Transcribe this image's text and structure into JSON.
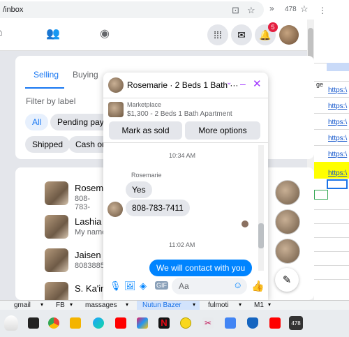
{
  "browser": {
    "url": "/inbox",
    "ext_count": "478"
  },
  "facebook": {
    "notif_badge": "5"
  },
  "sheet": {
    "cell_text": "ge",
    "links": [
      "https:\\",
      "https:\\",
      "https:\\",
      "https:\\",
      "https:\\",
      "https:\\",
      "https:\\"
    ]
  },
  "marketplace": {
    "tabs": [
      "Selling",
      "Buying"
    ],
    "filter_label": "Filter by label",
    "chips": [
      "All",
      "Pending paym",
      "Shipped",
      "Cash on"
    ],
    "listings": [
      {
        "name": "Rosema",
        "sub": "808-783-"
      },
      {
        "name": "Lashia ·",
        "sub": "My name"
      },
      {
        "name": "Jaisen ·",
        "sub": "80838850"
      },
      {
        "name": "S. Ka'im",
        "sub": ""
      }
    ]
  },
  "chat": {
    "title": "Rosemarie · 2 Beds 1 Bath ···",
    "source": "Marketplace",
    "item": "$1,300 - 2 Beds 1 Bath Apartment",
    "mark_sold": "Mark as sold",
    "more_options": "More options",
    "time1": "10:34 AM",
    "sender": "Rosemarie",
    "msg1": "Yes",
    "msg2": "808-783-7411",
    "time2": "11:02 AM",
    "msg_out": "We will contact with you",
    "composer_placeholder": "Aa"
  },
  "bookmarks": [
    "gmail",
    "FB",
    "massages",
    "Nutun Bazer",
    "fulmoti",
    "M1"
  ],
  "taskbar": {
    "badge": "478"
  },
  "colors": {
    "fb_blue": "#1877f2",
    "messenger_blue": "#0084ff",
    "chat_accent": "#a033ff",
    "notif_red": "#e41e3f",
    "sheet_highlight": "#ffff00"
  }
}
